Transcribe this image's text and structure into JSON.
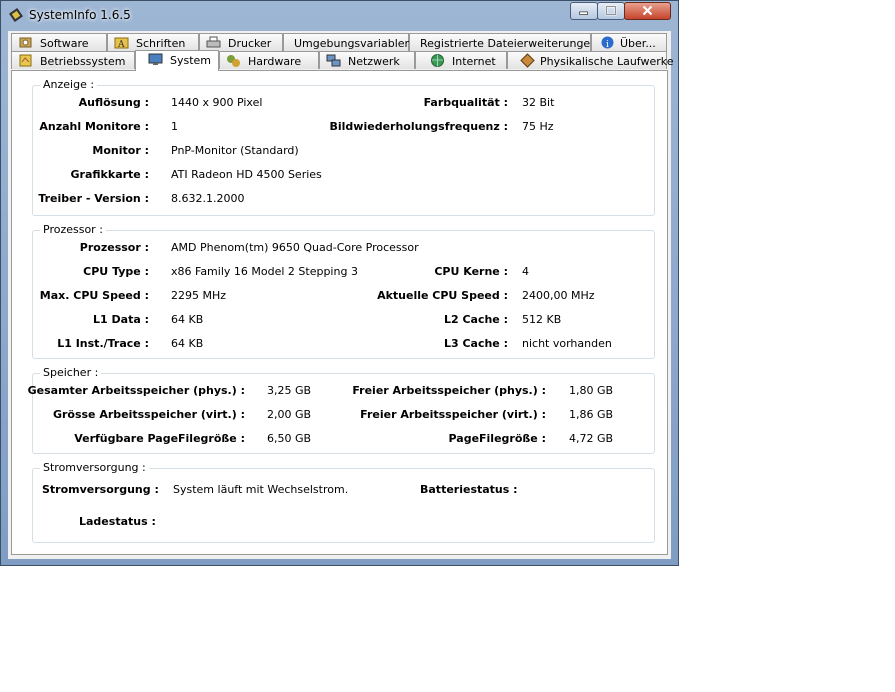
{
  "window": {
    "title": "SystemInfo 1.6.5"
  },
  "tabs_row1": [
    {
      "label": "Software",
      "icon": "cd-icon"
    },
    {
      "label": "Schriften",
      "icon": "font-icon"
    },
    {
      "label": "Drucker",
      "icon": "printer-icon"
    },
    {
      "label": "Umgebungsvariablen",
      "icon": ""
    },
    {
      "label": "Registrierte Dateierweiterungen",
      "icon": ""
    },
    {
      "label": "Über...",
      "icon": "info-icon"
    }
  ],
  "tabs_row2": [
    {
      "label": "Betriebssystem",
      "icon": "os-icon"
    },
    {
      "label": "System",
      "icon": "monitor-icon",
      "active": true
    },
    {
      "label": "Hardware",
      "icon": "hardware-icon"
    },
    {
      "label": "Netzwerk",
      "icon": "network-icon"
    },
    {
      "label": "Internet",
      "icon": "globe-icon"
    },
    {
      "label": "Physikalische Laufwerke",
      "icon": "drive-icon"
    }
  ],
  "anzeige": {
    "title": "Anzeige :",
    "aufloesung_label": "Auflösung :",
    "aufloesung": "1440 x 900 Pixel",
    "farbqualitaet_label": "Farbqualität :",
    "farbqualitaet": "32 Bit",
    "monitore_label": "Anzahl Monitore :",
    "monitore": "1",
    "frequenz_label": "Bildwiederholungsfrequenz :",
    "frequenz": "75 Hz",
    "monitor_label": "Monitor :",
    "monitor": "PnP-Monitor (Standard)",
    "grafikkarte_label": "Grafikkarte :",
    "grafikkarte": "ATI Radeon HD 4500 Series",
    "treiber_label": "Treiber - Version :",
    "treiber": "8.632.1.2000"
  },
  "prozessor": {
    "title": "Prozessor :",
    "prozessor_label": "Prozessor :",
    "prozessor": "AMD Phenom(tm) 9650 Quad-Core Processor",
    "cputyp_label": "CPU Type :",
    "cputyp": "x86 Family 16 Model 2 Stepping 3",
    "kerne_label": "CPU Kerne :",
    "kerne": "4",
    "maxspeed_label": "Max. CPU Speed :",
    "maxspeed": "2295 MHz",
    "aktspeed_label": "Aktuelle CPU Speed :",
    "aktspeed": "2400,00 MHz",
    "l1data_label": "L1 Data :",
    "l1data": "64 KB",
    "l2_label": "L2 Cache :",
    "l2": "512 KB",
    "l1inst_label": "L1 Inst./Trace :",
    "l1inst": "64 KB",
    "l3_label": "L3 Cache :",
    "l3": "nicht vorhanden"
  },
  "speicher": {
    "title": "Speicher :",
    "gesamt_label": "Gesamter Arbeitsspeicher (phys.) :",
    "gesamt": "3,25 GB",
    "frei_label": "Freier Arbeitsspeicher (phys.) :",
    "frei": "1,80 GB",
    "virt_label": "Grösse Arbeitsspeicher (virt.) :",
    "virt": "2,00 GB",
    "freivirt_label": "Freier Arbeitsspeicher (virt.) :",
    "freivirt": "1,86 GB",
    "pagefile_avail_label": "Verfügbare PageFilegröße :",
    "pagefile_avail": "6,50 GB",
    "pagefile_label": "PageFilegröße :",
    "pagefile": "4,72 GB"
  },
  "strom": {
    "title": "Stromversorgung :",
    "versorgung_label": "Stromversorgung :",
    "versorgung": "System läuft mit Wechselstrom.",
    "batterie_label": "Batteriestatus :",
    "lade_label": "Ladestatus :"
  }
}
